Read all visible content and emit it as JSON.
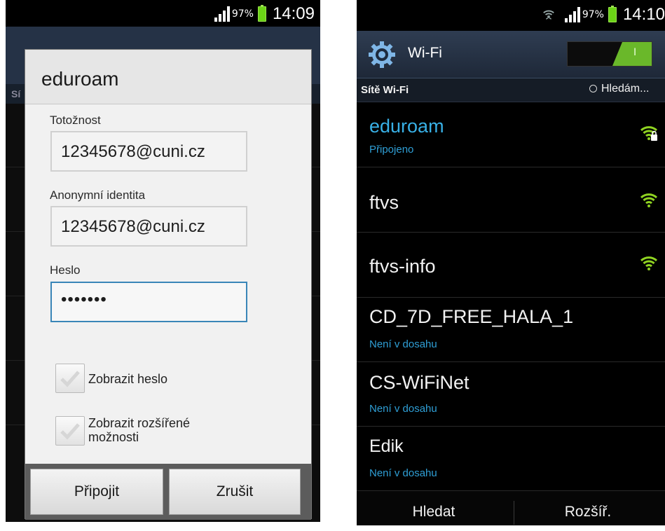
{
  "left": {
    "status": {
      "battery": "97%",
      "time": "14:09"
    },
    "background_fragments": [
      "Sí"
    ],
    "dialog": {
      "title": "eduroam",
      "identity_label": "Totožnost",
      "identity_value": "12345678@cuni.cz",
      "anon_label": "Anonymní identita",
      "anon_value": "12345678@cuni.cz",
      "password_label": "Heslo",
      "password_value": "•••••••",
      "show_password_label": "Zobrazit heslo",
      "show_advanced_label_line1": "Zobrazit rozšířené",
      "show_advanced_label_line2": "možnosti",
      "connect_button": "Připojit",
      "cancel_button": "Zrušit"
    }
  },
  "right": {
    "status": {
      "battery": "97%",
      "time": "14:10"
    },
    "header_title": "Wi-Fi",
    "toggle_text": "I",
    "section_title": "Sítě Wi-Fi",
    "searching_text": "Hledám...",
    "networks": [
      {
        "name": "eduroam",
        "status": "Připojeno",
        "signal_icon": "wifi-lock-icon"
      },
      {
        "name": "ftvs",
        "status": "",
        "signal_icon": "wifi-icon"
      },
      {
        "name": "ftvs-info",
        "status": "",
        "signal_icon": "wifi-icon"
      },
      {
        "name": "CD_7D_FREE_HALA_1",
        "status": "Není v dosahu",
        "signal_icon": ""
      },
      {
        "name": "CS-WiFiNet",
        "status": "Není v dosahu",
        "signal_icon": ""
      },
      {
        "name": "Edik",
        "status": "Není v dosahu",
        "signal_icon": ""
      }
    ],
    "bottom_buttons": [
      "Hledat",
      "Rozšíř."
    ]
  },
  "colors": {
    "accent_blue": "#38b0e6",
    "signal_green": "#8fd321",
    "toggle_green": "#6ab82a"
  }
}
